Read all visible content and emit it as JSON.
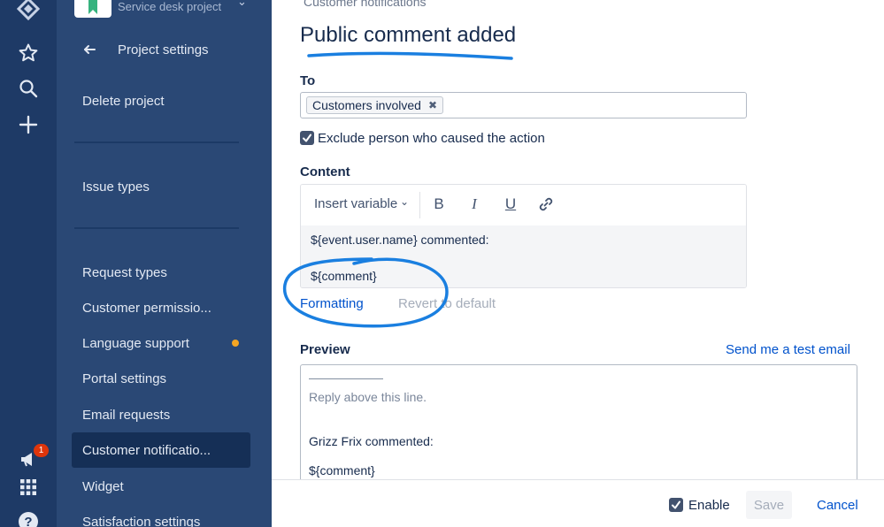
{
  "global_nav": {
    "notification_count": "1",
    "icons": [
      "jira-logo-icon",
      "star-icon",
      "search-icon",
      "plus-icon",
      "megaphone-icon",
      "app-grid-icon",
      "help-icon"
    ]
  },
  "sidebar": {
    "project_type": "Service desk project",
    "section_title": "Project settings",
    "items": [
      {
        "label": "Delete project"
      },
      {
        "label": "Issue types"
      },
      {
        "label": "Request types"
      },
      {
        "label": "Customer permissio..."
      },
      {
        "label": "Language support"
      },
      {
        "label": "Portal settings"
      },
      {
        "label": "Email requests"
      },
      {
        "label": "Customer notificatio..."
      },
      {
        "label": "Widget"
      },
      {
        "label": "Satisfaction settings"
      }
    ],
    "active_index": 7
  },
  "main": {
    "breadcrumb": "Customer notifications",
    "title": "Public comment added",
    "to": {
      "label": "To",
      "chip": "Customers involved"
    },
    "exclude": {
      "label": "Exclude person who caused the action",
      "checked": true
    },
    "content": {
      "label": "Content",
      "insert_variable": "Insert variable",
      "toolbar": {
        "bold": "B",
        "italic": "I",
        "underline": "U"
      },
      "line1": "${event.user.name} commented:",
      "line2": "${comment}"
    },
    "formatting_link": "Formatting",
    "revert_link": "Revert to default",
    "preview": {
      "label": "Preview",
      "test_email_link": "Send me a test email",
      "rule": "——————",
      "reply_hint": "Reply above this line.",
      "commenter_line": "Grizz Frix commented:",
      "comment_var": "${comment}"
    }
  },
  "footer": {
    "enable_label": "Enable",
    "enable_checked": true,
    "save_label": "Save",
    "cancel_label": "Cancel"
  },
  "colors": {
    "nav_bg": "#1e3a66",
    "sidebar_bg": "#2a4875",
    "active_bg": "#152f56",
    "link": "#0052cc",
    "annotation": "#1a7fe0",
    "badge": "#de350b",
    "dot": "#f5a623"
  }
}
